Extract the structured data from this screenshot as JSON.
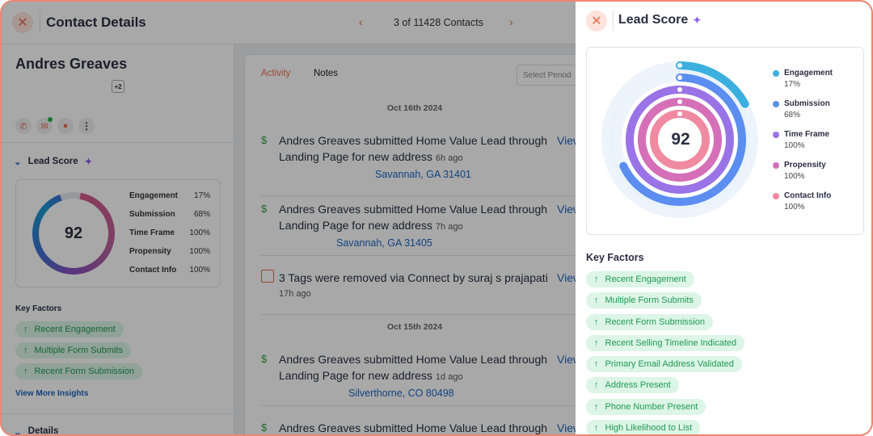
{
  "header": {
    "title": "Contact Details",
    "pager": "3 of 11428 Contacts"
  },
  "contact": {
    "name": "Andres Greaves",
    "extra_badge": "+2"
  },
  "left_lead_score": {
    "title": "Lead Score",
    "score": "92",
    "rows": [
      {
        "label": "Engagement",
        "value": "17%"
      },
      {
        "label": "Submission",
        "value": "68%"
      },
      {
        "label": "Time Frame",
        "value": "100%"
      },
      {
        "label": "Propensity",
        "value": "100%"
      },
      {
        "label": "Contact Info",
        "value": "100%"
      }
    ],
    "key_factors_title": "Key Factors",
    "key_factors": [
      "Recent Engagement",
      "Multiple Form Submits",
      "Recent Form Submission"
    ],
    "view_more": "View More Insights"
  },
  "details_title": "Details",
  "activity": {
    "tabs": [
      "Activity",
      "Notes"
    ],
    "period_placeholder": "Select Period",
    "view_label": "View",
    "dates": [
      "Oct 16th 2024",
      "Oct 15th 2024"
    ],
    "items": [
      {
        "text": "Andres Greaves submitted Home Value Lead through Landing Page for new address",
        "ago": "6h ago",
        "location": "Savannah, GA 31401"
      },
      {
        "text": "Andres Greaves submitted Home Value Lead through Landing Page for new address",
        "ago": "7h ago",
        "location": "Savannah, GA 31405"
      },
      {
        "text": "3 Tags were removed via Connect by suraj s prajapati",
        "ago": "17h ago"
      },
      {
        "text": "Andres Greaves submitted Home Value Lead through Landing Page for new address",
        "ago": "1d ago",
        "location": "Silverthorne, CO 80498"
      },
      {
        "text": "Andres Greaves submitted Home Value Lead through"
      }
    ]
  },
  "panel": {
    "title": "Lead Score",
    "key_factors_title": "Key Factors",
    "key_factors": [
      "Recent Engagement",
      "Multiple Form Submits",
      "Recent Form Submission",
      "Recent Selling Timeline Indicated",
      "Primary Email Address Validated",
      "Address Present",
      "Phone Number Present",
      "High Likelihood to List"
    ]
  },
  "chart_data": {
    "type": "radial-bar",
    "center_label": "92",
    "series": [
      {
        "name": "Engagement",
        "value": 17,
        "label": "17%",
        "color": "#3bb0de"
      },
      {
        "name": "Submission",
        "value": 68,
        "label": "68%",
        "color": "#5b8ef0"
      },
      {
        "name": "Time Frame",
        "value": 100,
        "label": "100%",
        "color": "#9a73e6"
      },
      {
        "name": "Propensity",
        "value": 100,
        "label": "100%",
        "color": "#d46fb8"
      },
      {
        "name": "Contact Info",
        "value": 100,
        "label": "100%",
        "color": "#f08aa0"
      }
    ],
    "ylim": [
      0,
      100
    ],
    "legend": "right"
  },
  "colors": {
    "accent": "#ea6a52",
    "link": "#1c64c0",
    "chip_bg": "#dcf5e6",
    "chip_text": "#1f9a55",
    "frame": "#f08570"
  }
}
